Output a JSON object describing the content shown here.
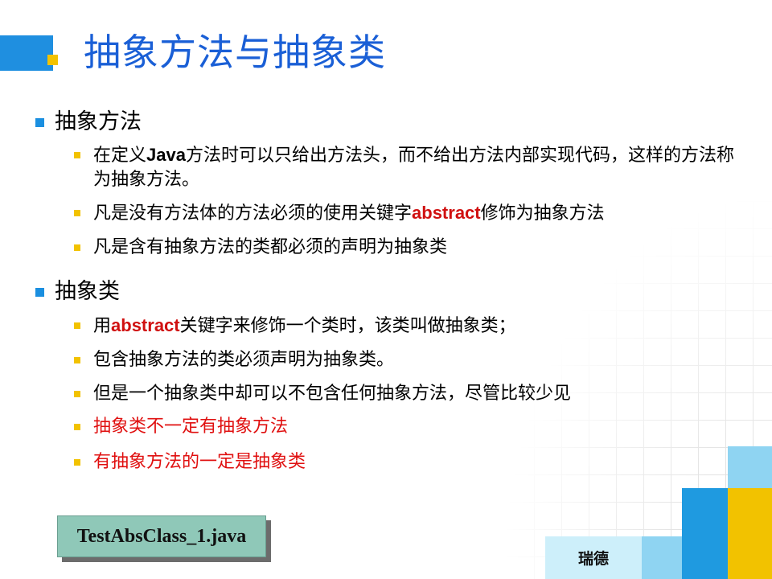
{
  "slide": {
    "title": "抽象方法与抽象类",
    "sections": [
      {
        "heading": "抽象方法",
        "items": [
          {
            "parts": [
              {
                "t": "在定义"
              },
              {
                "t": "Java",
                "cls": "bold-latin"
              },
              {
                "t": "方法时可以只给出方法头，而不给出方法内部实现代码，这样的方法称为抽象方法。"
              }
            ]
          },
          {
            "parts": [
              {
                "t": "凡是没有方法体的方法必须的使用关键字"
              },
              {
                "t": "abstract",
                "cls": "kw"
              },
              {
                "t": "修饰为抽象方法"
              }
            ]
          },
          {
            "parts": [
              {
                "t": "凡是含有抽象方法的类都必须的声明为抽象类"
              }
            ]
          }
        ]
      },
      {
        "heading": "抽象类",
        "items": [
          {
            "parts": [
              {
                "t": "用"
              },
              {
                "t": "abstract",
                "cls": "kw"
              },
              {
                "t": "关键字来修饰一个类时，该类叫做抽象类；"
              }
            ]
          },
          {
            "parts": [
              {
                "t": "包含抽象方法的类必须声明为抽象类。"
              }
            ]
          },
          {
            "parts": [
              {
                "t": "但是一个抽象类中却可以不包含任何抽象方法，尽管比较少见"
              }
            ]
          },
          {
            "parts": [
              {
                "t": "抽象类不一定有抽象方法",
                "cls": "red"
              }
            ]
          },
          {
            "parts": [
              {
                "t": "有抽象方法的一定是抽象类",
                "cls": "red"
              }
            ]
          }
        ]
      }
    ],
    "file_label": "TestAbsClass_1.java",
    "footer": "瑞德"
  },
  "colors": {
    "title": "#1a5fd6",
    "keyword": "#d01010",
    "accent_blue": "#1f8fe0",
    "accent_yellow": "#f2c200"
  }
}
